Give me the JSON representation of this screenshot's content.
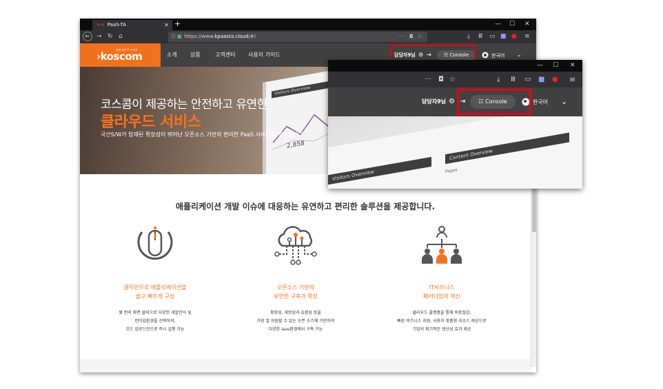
{
  "browser": {
    "tab_title": "PaaS-TA",
    "url": "https://www.kpaasta.cloud/#/",
    "url_host_prefix": "https://www.",
    "url_host": "kpaasta.cloud",
    "url_path": "/#/"
  },
  "site": {
    "logo_text": "›koscom",
    "logo_subtext": "자본시장 IT 서비스",
    "nav": [
      "소개",
      "상품",
      "고객센터",
      "사용자 가이드"
    ],
    "user_label": "담당자9님",
    "console_label": "Console",
    "language_label": "한국어"
  },
  "hero": {
    "line1": "코스콤이 제공하는 안전하고 유연한",
    "line2": "클라우드 서비스",
    "line3": "국산S/W가 탑재된 확장성이 뛰어난 오픈소스 기반의 편리한 PaaS 서비스를 제공합니다",
    "screen_label": "Visitors Overview",
    "screen_number": "2,858"
  },
  "tagline": "애플리케이션 개발 이슈에 대응하는 유연하고 편리한 솔루션을 제공합니다.",
  "features": [
    {
      "icon": "mouse-icon",
      "title_line1": "클릭만으로 애플리케이션을",
      "title_line2": "쉽고 빠르게 구성",
      "desc": [
        "몇 번의 화면 클릭으로 다양한 개발언어 및",
        "런타임환경을 선택하여,",
        "코드 업로드만으로 즉시 실행 가능"
      ]
    },
    {
      "icon": "cloud-network-icon",
      "title_line1": "오픈소스 기반의",
      "title_line2": "유연한 구축과 확장",
      "desc": [
        "확장성, 개방성과 호환성 등을",
        "가장 잘 지원할 수 있는 오픈 소스에 기반하여",
        "다양한 Iaas환경에서 구축 가능"
      ]
    },
    {
      "icon": "business-hierarchy-icon",
      "title_line1": "IT비즈니스",
      "title_line2": "패러다임의 혁신",
      "desc": [
        "클라우드 플랫폼을 통해 비용절감,",
        "빠른 비즈니스 지원, 사용자 맞춤형 리소스 제공으로",
        "기업의 획기적인 생산성 효과 제공"
      ]
    }
  ],
  "inset": {
    "user_label": "담당자9님",
    "console_label": "Console",
    "language_label": "한국어",
    "screen_label1": "Visitors Overview",
    "screen_label2": "Content Overview",
    "screen_label3": "Pages"
  },
  "colors": {
    "brand_orange": "#f2711c",
    "header_dark": "#414141",
    "highlight_red": "#e60012"
  }
}
